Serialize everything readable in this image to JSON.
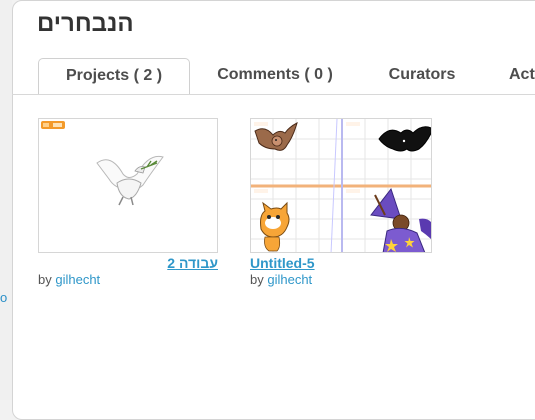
{
  "page": {
    "title": "הנבחרים"
  },
  "tabs": [
    {
      "label": "Projects ( 2 )",
      "active": true
    },
    {
      "label": "Comments ( 0 )",
      "active": false
    },
    {
      "label": "Curators",
      "active": false
    },
    {
      "label": "Act",
      "active": false
    }
  ],
  "projects": [
    {
      "title": "עבודה 2",
      "by_prefix": "by",
      "author": "gilhecht",
      "thumb_icon": "white-dove-icon"
    },
    {
      "title": "Untitled-5",
      "by_prefix": "by",
      "author": "gilhecht",
      "thumb_icon": "bat-cat-wizard-collage"
    }
  ],
  "left_edge": {
    "glyph": "o"
  },
  "colors": {
    "link": "#2f97c9",
    "title": "#333333",
    "tab_text": "#4d4d4d"
  }
}
